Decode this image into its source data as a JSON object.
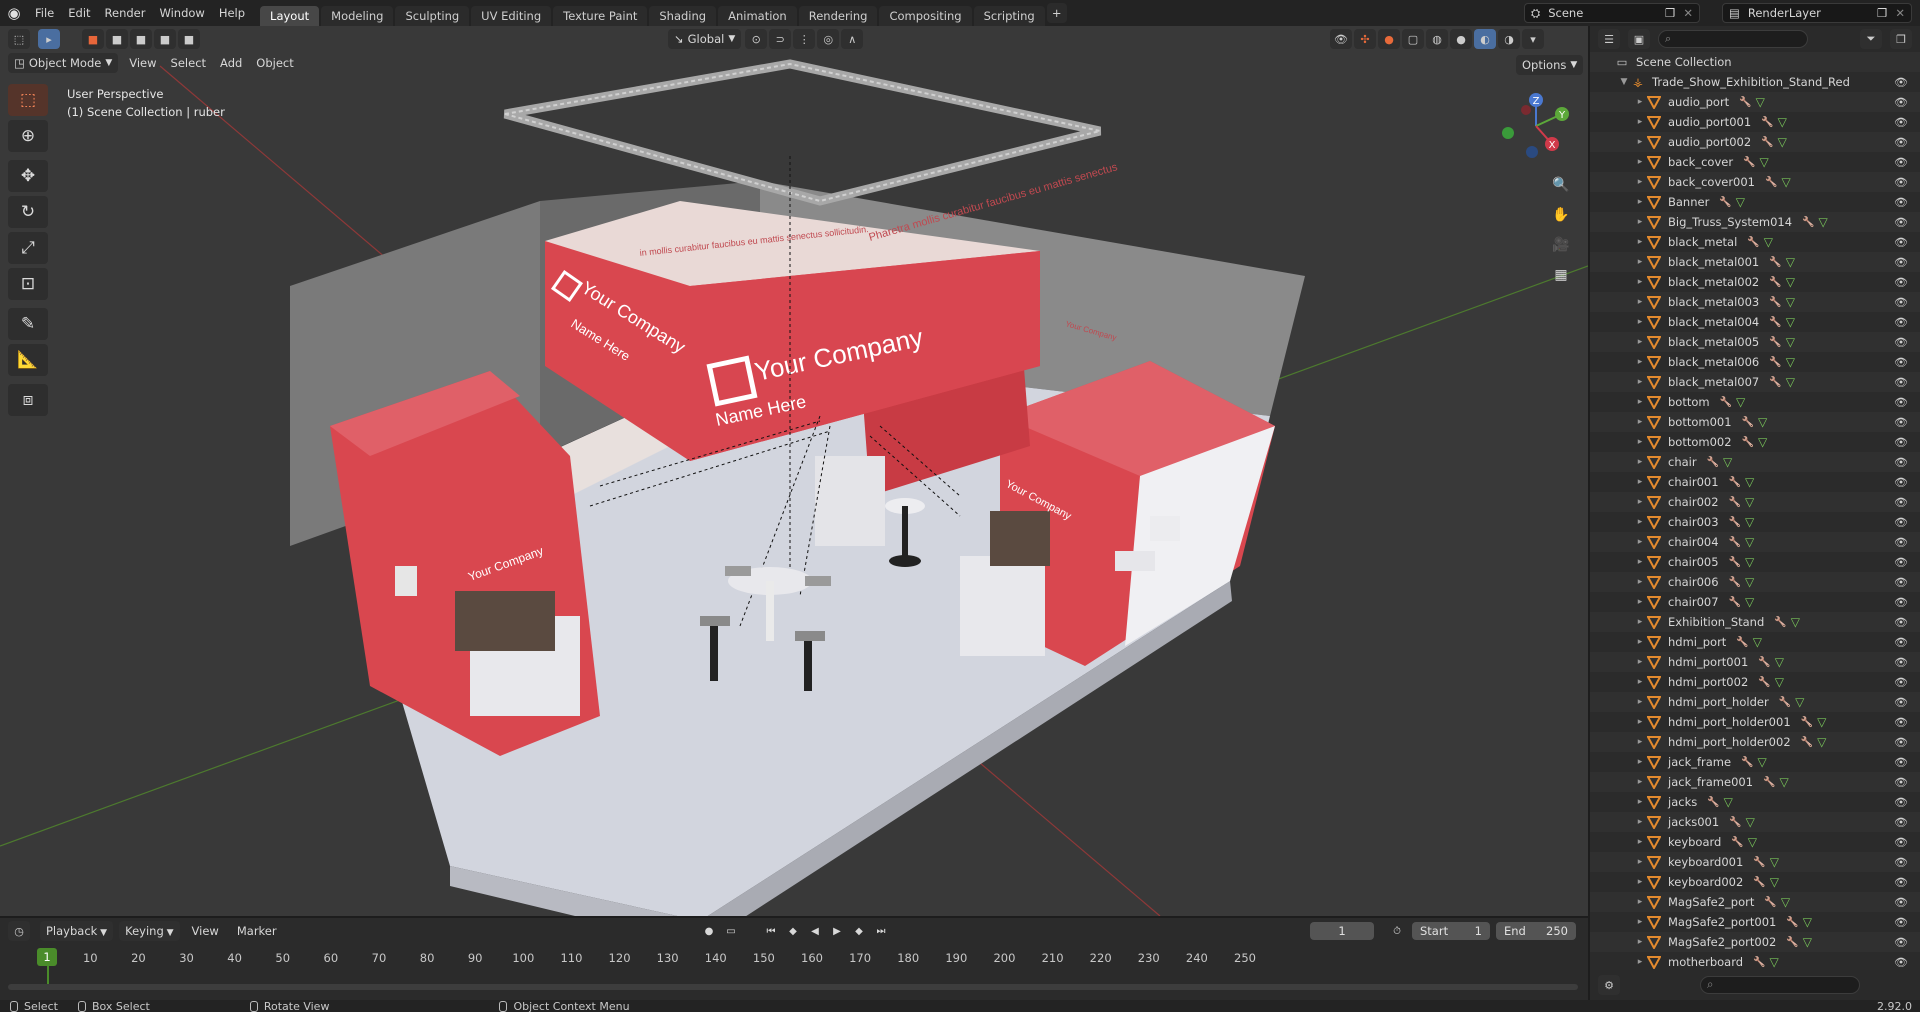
{
  "topbar": {
    "menus": [
      "File",
      "Edit",
      "Render",
      "Window",
      "Help"
    ],
    "workspaces": [
      "Layout",
      "Modeling",
      "Sculpting",
      "UV Editing",
      "Texture Paint",
      "Shading",
      "Animation",
      "Rendering",
      "Compositing",
      "Scripting"
    ],
    "active_workspace": "Layout",
    "scene": "Scene",
    "render_layer": "RenderLayer"
  },
  "viewport": {
    "mode": "Object Mode",
    "menus": [
      "View",
      "Select",
      "Add",
      "Object"
    ],
    "transform_orientation": "Global",
    "options_label": "Options",
    "perspective_label": "User Perspective",
    "collection_label": "(1) Scene Collection | ruber",
    "axes": {
      "x": "X",
      "y": "Y",
      "z": "Z"
    },
    "scene_text": {
      "company": "Your Company",
      "name": "Name Here",
      "side_banner": "Pharetra mollis curabitur faucibus eu mattis senectus",
      "banner_top": "in mollis curabitur faucibus eu mattis senectus sollicitudin."
    }
  },
  "outliner": {
    "root": "Scene Collection",
    "collection": "Trade_Show_Exhibition_Stand_Red",
    "items": [
      "audio_port",
      "audio_port001",
      "audio_port002",
      "back_cover",
      "back_cover001",
      "Banner",
      "Big_Truss_System014",
      "black_metal",
      "black_metal001",
      "black_metal002",
      "black_metal003",
      "black_metal004",
      "black_metal005",
      "black_metal006",
      "black_metal007",
      "bottom",
      "bottom001",
      "bottom002",
      "chair",
      "chair001",
      "chair002",
      "chair003",
      "chair004",
      "chair005",
      "chair006",
      "chair007",
      "Exhibition_Stand",
      "hdmi_port",
      "hdmi_port001",
      "hdmi_port002",
      "hdmi_port_holder",
      "hdmi_port_holder001",
      "hdmi_port_holder002",
      "jack_frame",
      "jack_frame001",
      "jacks",
      "jacks001",
      "keyboard",
      "keyboard001",
      "keyboard002",
      "MagSafe2_port",
      "MagSafe2_port001",
      "MagSafe2_port002",
      "motherboard"
    ]
  },
  "timeline": {
    "menus": [
      "Playback",
      "Keying",
      "View",
      "Marker"
    ],
    "current_frame": "1",
    "start_label": "Start",
    "start": "1",
    "end_label": "End",
    "end": "250",
    "ticks": [
      "1",
      "10",
      "20",
      "30",
      "40",
      "50",
      "60",
      "70",
      "80",
      "90",
      "100",
      "110",
      "120",
      "130",
      "140",
      "150",
      "160",
      "170",
      "180",
      "190",
      "200",
      "210",
      "220",
      "230",
      "240",
      "250"
    ]
  },
  "statusbar": {
    "select": "Select",
    "box_select": "Box Select",
    "rotate": "Rotate View",
    "context": "Object Context Menu",
    "version": "2.92.0"
  },
  "colors": {
    "accent": "#4a6ea0",
    "stand_red": "#d9474f",
    "floor": "#d6d8e0",
    "timeline_green": "#4a8c2a",
    "object_orange": "#e38a2e"
  }
}
